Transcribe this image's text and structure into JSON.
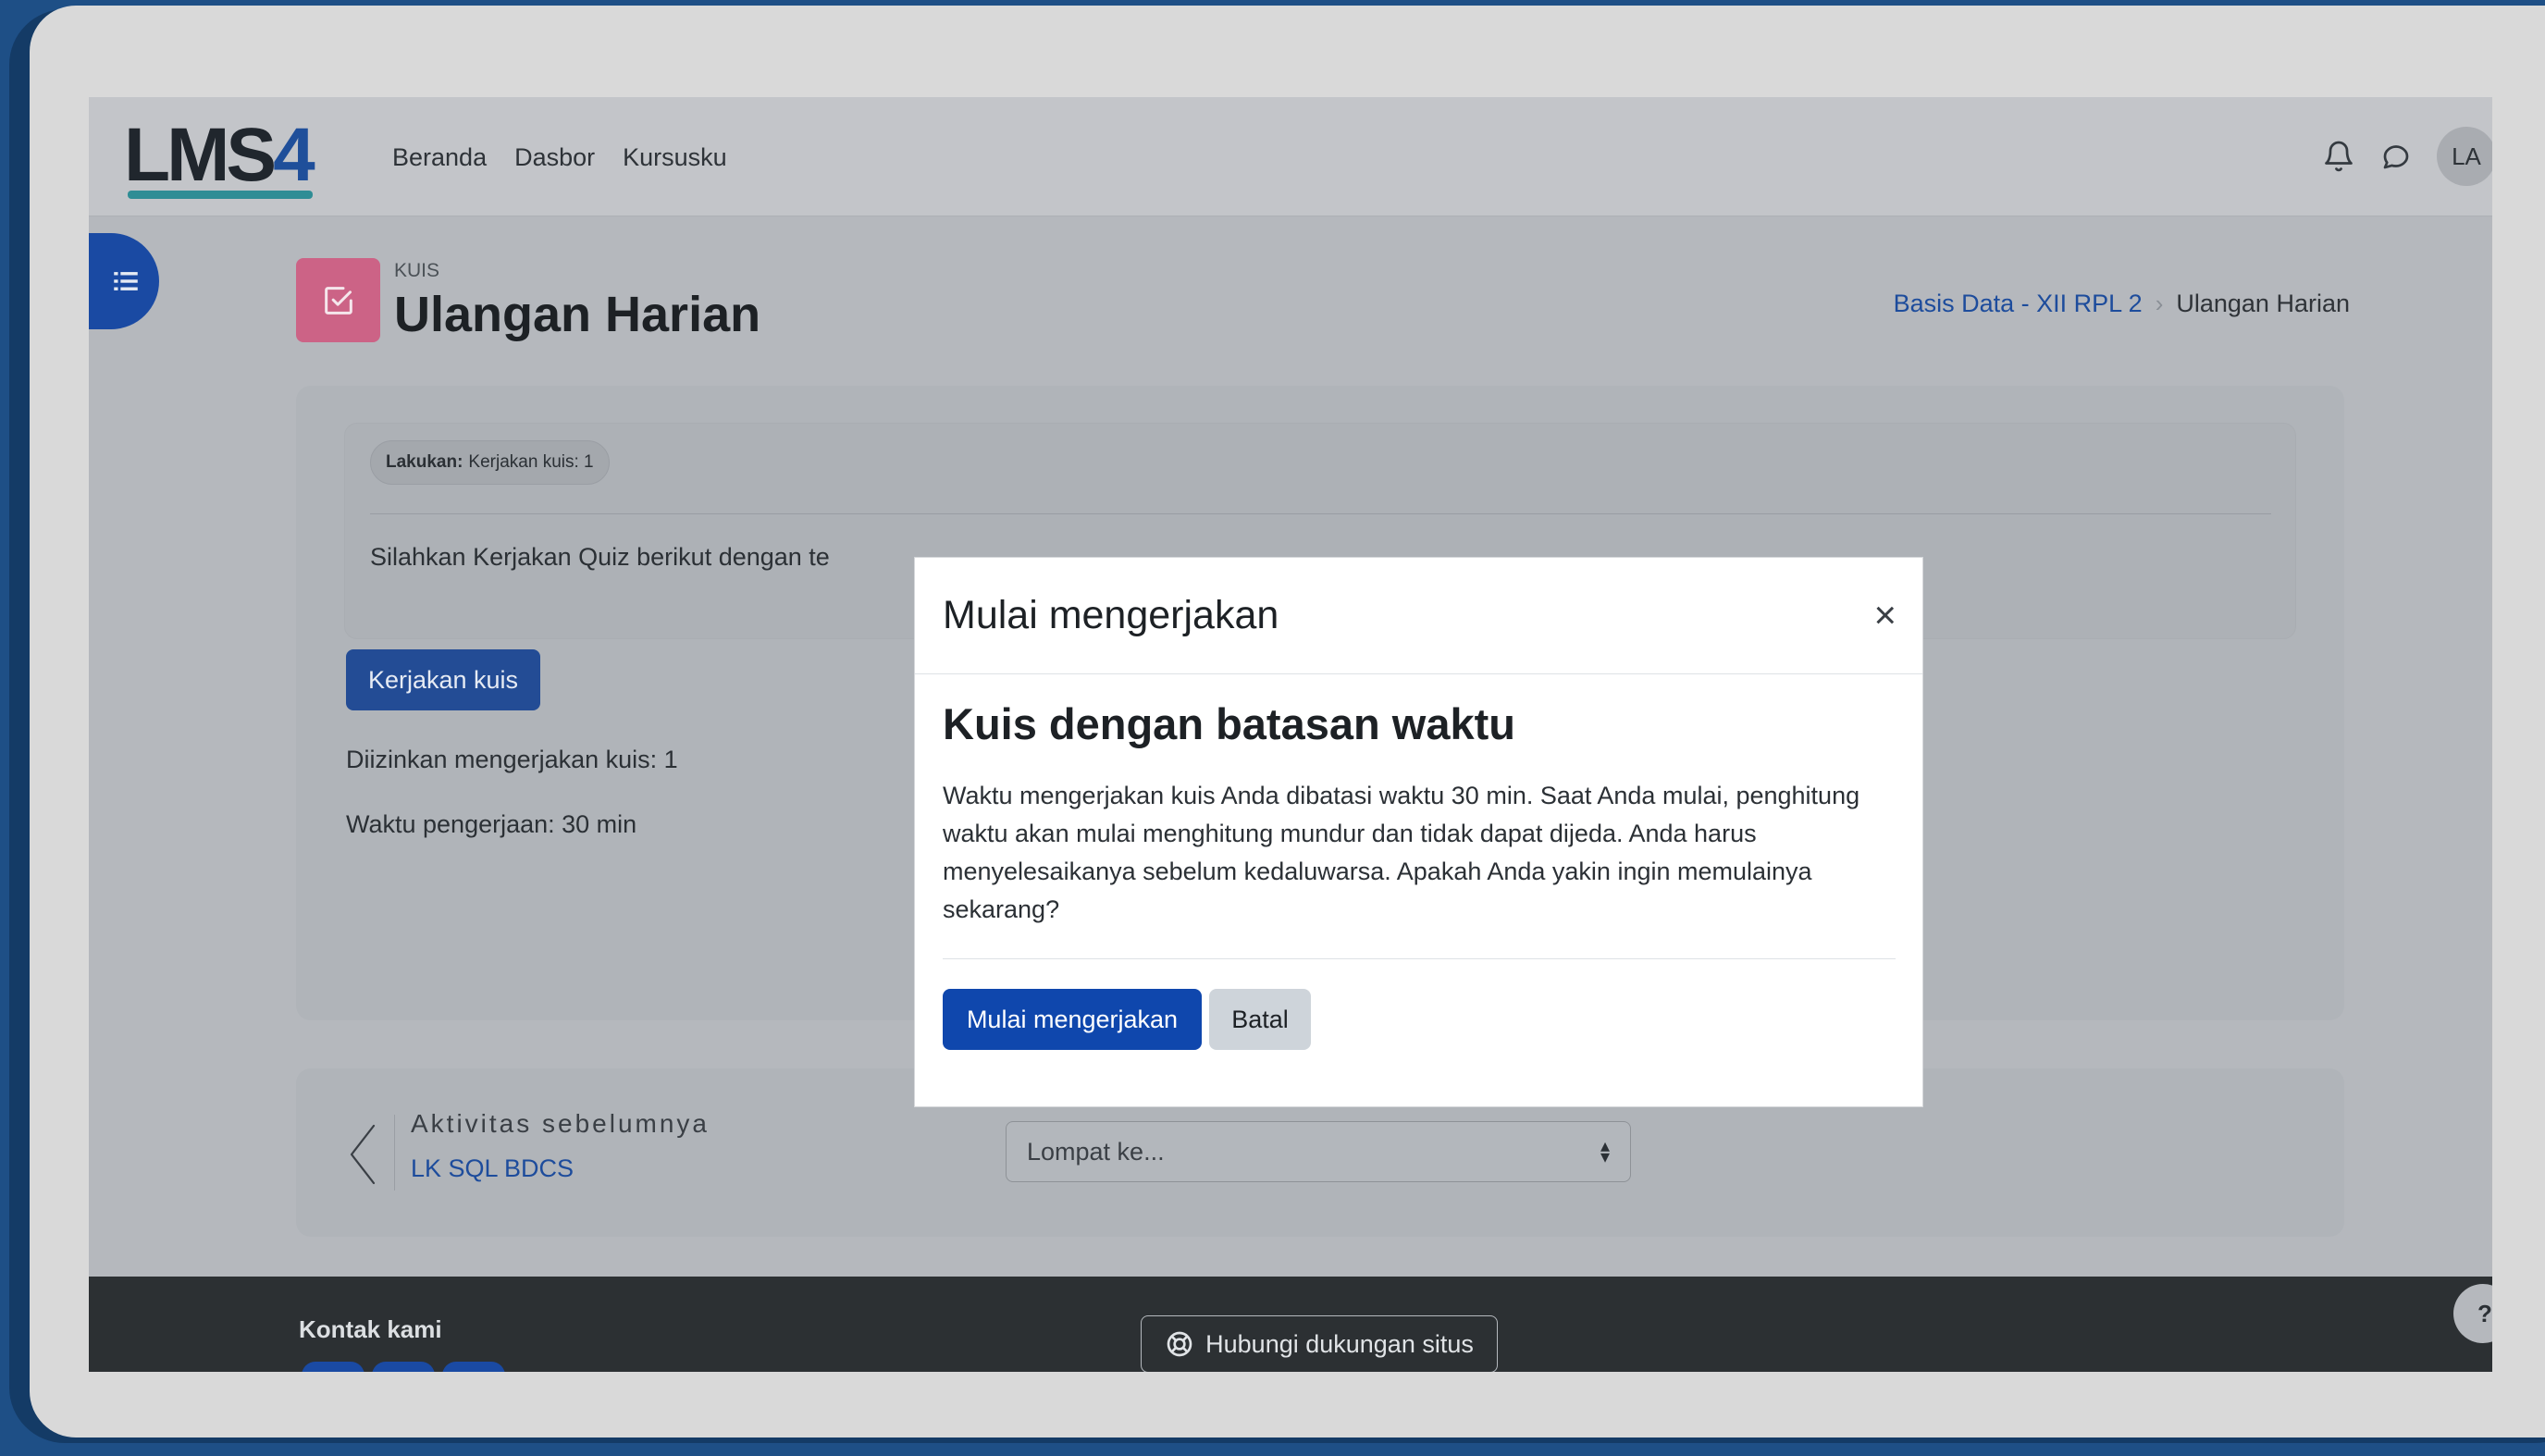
{
  "app": {
    "logo_text": "LMS",
    "logo_digit": "4"
  },
  "nav": {
    "links": [
      "Beranda",
      "Dasbor",
      "Kursusku"
    ],
    "avatar_initials": "LA",
    "icons": [
      "bell-icon",
      "chat-icon"
    ]
  },
  "header": {
    "activity_type": "KUIS",
    "title": "Ulangan Harian",
    "breadcrumb": [
      "Basis Data - XII RPL 2",
      "Ulangan Harian"
    ]
  },
  "activity": {
    "completion_label": "Lakukan:",
    "completion_value": "Kerjakan kuis: 1",
    "intro_text": "Silahkan Kerjakan Quiz berikut dengan te",
    "attempt_button": "Kerjakan kuis",
    "attempts_allowed": "Diizinkan mengerjakan kuis: 1",
    "time_limit": "Waktu pengerjaan: 30 min"
  },
  "activity_nav": {
    "prev_label": "Aktivitas sebelumnya",
    "prev_link": "LK SQL BDCS",
    "jump_placeholder": "Lompat ke..."
  },
  "footer": {
    "contact_title": "Kontak kami",
    "support_button": "Hubungi dukungan situs",
    "help_label": "?"
  },
  "modal": {
    "title": "Mulai mengerjakan",
    "close_label": "×",
    "heading": "Kuis dengan batasan waktu",
    "body": "Waktu mengerjakan kuis Anda dibatasi waktu 30 min. Saat Anda mulai, penghitung waktu akan mulai menghitung mundur dan tidak dapat dijeda. Anda harus menyelesaikanya sebelum kedaluwarsa. Apakah Anda yakin ingin memulainya sekarang?",
    "primary_button": "Mulai mengerjakan",
    "secondary_button": "Batal"
  },
  "colors": {
    "primary": "#0f47ad",
    "link": "#1d4c9c",
    "quiz_icon": "#cc6386",
    "footer_bg": "#2c3033"
  }
}
